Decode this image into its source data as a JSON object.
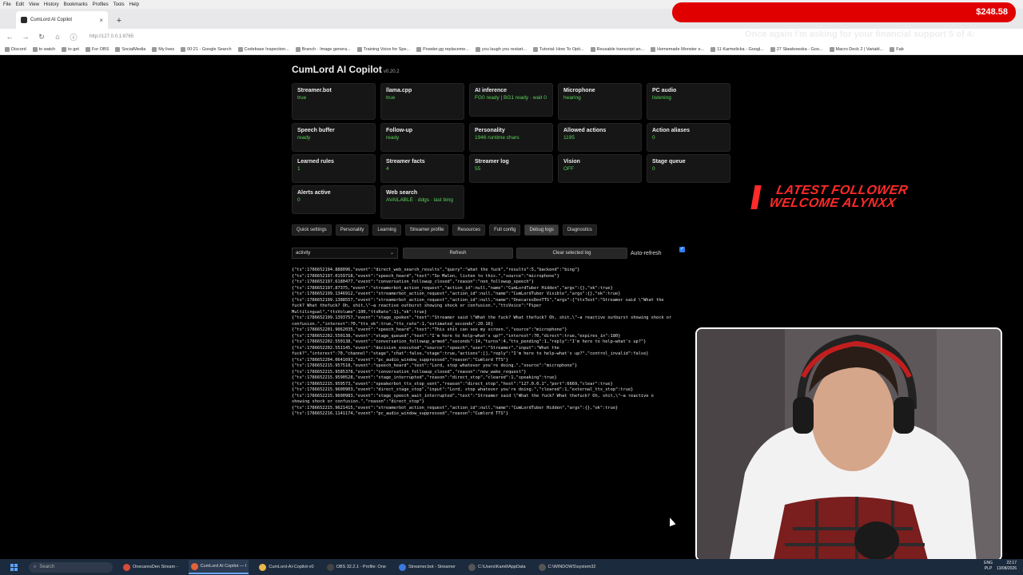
{
  "browser": {
    "menu": [
      "File",
      "Edit",
      "View",
      "History",
      "Bookmarks",
      "Profiles",
      "Tools",
      "Help"
    ],
    "tab_title": "CumLord AI Copilot",
    "url": "http://127.0.0.1:8765",
    "bookmarks": [
      "Discord",
      "to watch",
      "to get",
      "For OBS",
      "SocialMedia",
      "My lives",
      "00:21 - Google Search",
      "Codebase Inspection...",
      "Branch · Image genera...",
      "Training Voice for Spe...",
      "Powder.gg replaceme...",
      "you laugh you restart...",
      "Tutorial: How To Opti...",
      "Reusable transcript an...",
      "Homemade Monster e...",
      "11 Karmelicka - Googl...",
      "27 Sławkowska - Goo...",
      "Macro Deck 2 | Variabl...",
      "Fab"
    ]
  },
  "app": {
    "title": "CumLord AI Copilot",
    "version": "v0.20.2",
    "cards": [
      {
        "name": "Streamer.bot",
        "value": "true"
      },
      {
        "name": "llama.cpp",
        "value": "true"
      },
      {
        "name": "AI inference",
        "value": "FG0 ready | BG1 ready · wait 0"
      },
      {
        "name": "Microphone",
        "value": "hearing"
      },
      {
        "name": "PC audio",
        "value": "listening"
      },
      {
        "name": "Speech buffer",
        "value": "ready"
      },
      {
        "name": "Follow-up",
        "value": "ready"
      },
      {
        "name": "Personality",
        "value": "1946 runtime chars"
      },
      {
        "name": "Allowed actions",
        "value": "1195"
      },
      {
        "name": "Action aliases",
        "value": "0"
      },
      {
        "name": "Learned rules",
        "value": "1"
      },
      {
        "name": "Streamer facts",
        "value": "4"
      },
      {
        "name": "Streamer log",
        "value": "55"
      },
      {
        "name": "Vision",
        "value": "OFF"
      },
      {
        "name": "Stage queue",
        "value": "0"
      },
      {
        "name": "Alerts active",
        "value": "0"
      },
      {
        "name": "Web search",
        "value": "AVAILABLE · ddgs · last bing"
      }
    ],
    "tabs": [
      "Quick settings",
      "Personality",
      "Learning",
      "Streamer profile",
      "Resources",
      "Full config",
      "Debug logs",
      "Diagnostics"
    ],
    "active_tab": "Debug logs",
    "log_select": "activity",
    "refresh_label": "Refresh",
    "clear_label": "Clear selected log",
    "auto_refresh_label": "Auto-refresh",
    "log_lines": [
      "{\"ts\":1786652194.888096,\"event\":\"direct_web_search_results\",\"query\":\"what the fuck\",\"results\":5,\"backend\":\"bing\"}",
      "{\"ts\":1786652197.0159718,\"event\":\"speech_heard\",\"text\":\"So Malen, listen to this.\",\"source\":\"microphone\"}",
      "{\"ts\":1786652197.6180477,\"event\":\"conversation_followup_closed\",\"reason\":\"non_followup_speech\"}",
      "{\"ts\":1786652197.87375,\"event\":\"streamerbot_action_request\",\"action_id\":null,\"name\":\"CumLordTuber Hidden\",\"args\":{},\"ok\":true}",
      "{\"ts\":1786652199.1346912,\"event\":\"streamerbot_action_request\",\"action_id\":null,\"name\":\"CumLordTuber Visible\",\"args\":{},\"ok\":true}",
      "{\"ts\":1786652199.1388557,\"event\":\"streamerbot_action_request\",\"action_id\":null,\"name\":\"OnecaresDenTTS\",\"args\":{\"ttsText\":\"Streamer said \\\"What the",
      "fuck? What thefuck? Oh, shit,\\\"—a reactive outburst showing shock or confusion.\",\"ttsVoice\":\"Piper",
      "Multilingual\",\"ttsVolume\":100,\"ttsRate\":1},\"ok\":true}",
      "{\"ts\":1786652199.1393757,\"event\":\"stage_spoken\",\"text\":\"Streamer said \\\"What the fuck? What thefuck? Oh, shit,\\\"—a reactive outburst showing shock or",
      "confusion.\",\"interest\":70,\"tts_ok\":true,\"tts_rate\":1,\"estimated_seconds\":20.16}",
      "{\"ts\":1786652201.9062035,\"event\":\"speech_heard\",\"text\":\"This shit can see my screen.\",\"source\":\"microphone\"}",
      "{\"ts\":1786652202.550138,\"event\":\"stage_queued\",\"text\":\"I'm here to help—what's up?\",\"interest\":70,\"direct\":true,\"expires_in\":180}",
      "{\"ts\":1786652202.550138,\"event\":\"conversation_followup_armed\",\"seconds\":14,\"turns\":4,\"tts_pending\":1,\"reply\":\"I'm here to help—what's up?\"}",
      "{\"ts\":1786652202.551145,\"event\":\"decision_executed\",\"source\":\"speech\",\"user\":\"Streamer\",\"input\":\"What the",
      "fuck?\",\"interest\":70,\"channel\":\"stage\",\"chat\":false,\"stage\":true,\"actions\":[],\"reply\":\"I'm here to help—what's up?\",\"control_invalid\":false}",
      "{\"ts\":1786652204.0641692,\"event\":\"pc_audio_window_suppressed\",\"reason\":\"Cumlord TTS\"}",
      "{\"ts\":1786652215.957518,\"event\":\"speech_heard\",\"text\":\"Lord, stop whatever you're doing.\",\"source\":\"microphone\"}",
      "{\"ts\":1786652215.9585378,\"event\":\"conversation_followup_closed\",\"reason\":\"new_wake_request\"}",
      "{\"ts\":1786652215.9590528,\"event\":\"stage_interrupted\",\"reason\":\"direct_stop\",\"cleared\":1,\"speaking\":true}",
      "{\"ts\":1786652215.959573,\"event\":\"speakerbot_tts_stop_sent\",\"reason\":\"direct_stop\",\"host\":\"127.0.0.1\",\"port\":6669,\"clear\":true}",
      "{\"ts\":1786652215.9600903,\"event\":\"direct_stage_stop\",\"input\":\"Lord, stop whatever you're doing.\",\"cleared\":1,\"external_tts_stop\":true}",
      "{\"ts\":1786652215.9600983,\"event\":\"stage_speech_wait_interrupted\",\"text\":\"Streamer said \\\"What the fuck? What thefuck? Oh, shit,\\\"—a reactive o",
      "showing shock or confusion.\",\"reason\":\"direct_stop\"}",
      "{\"ts\":1786652215.9621415,\"event\":\"streamerbot_action_request\",\"action_id\":null,\"name\":\"CumLordTuber Hidden\",\"args\":{},\"ok\":true}",
      "{\"ts\":1786652216.1141174,\"event\":\"pc_audio_window_suppressed\",\"reason\":\"Cumlord TTS\"}"
    ]
  },
  "overlay": {
    "donation_amount": "$248.58",
    "ticker": "Once again i'm asking for your financial support 5 of 4:",
    "follower_line1": "LATEST FOLLOWER",
    "follower_line2": "WELCOME ALYNXX"
  },
  "taskbar": {
    "search_placeholder": "Search",
    "items": [
      "OnecaresDen Stream -",
      "CumLord AI Copilot — I",
      "CumLord-AI-Copilot-v0",
      "OBS 32.2.1 - Profile: One",
      "Streamer.bot - Streamer",
      "C:\\Users\\Kamil\\AppData",
      "C:\\WINDOWS\\system32"
    ],
    "active_item": 1,
    "lang": "ENG",
    "locale": "PLP",
    "time": "22:17",
    "date": "13/08/2026"
  },
  "colors": {
    "status_green": "#5bd35b",
    "donation_red": "#e00000",
    "follower_red": "#ff2a2a"
  }
}
